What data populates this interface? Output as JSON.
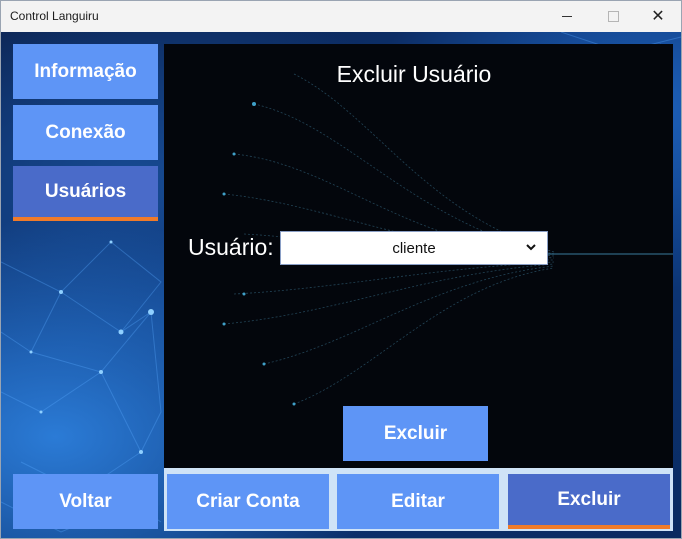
{
  "window": {
    "title": "Control Languiru",
    "minimize_icon": "minimize-icon",
    "maximize_icon": "maximize-icon",
    "close_glyph": "✕"
  },
  "sidebar": {
    "items": [
      {
        "label": "Informação"
      },
      {
        "label": "Conexão"
      },
      {
        "label": "Usuários",
        "active": true
      }
    ],
    "back_label": "Voltar"
  },
  "main": {
    "title": "Excluir Usuário",
    "user_label": "Usuário:",
    "user_select": {
      "value": "cliente",
      "chevron": "⌄"
    },
    "delete_button": "Excluir"
  },
  "bottom_tabs": [
    {
      "label": "Criar Conta"
    },
    {
      "label": "Editar"
    },
    {
      "label": "Excluir",
      "active": true
    }
  ],
  "colors": {
    "button": "#5e95f6",
    "active_button": "#4a6bc9",
    "active_underline": "#f07b2a",
    "panel": "#03060c"
  }
}
